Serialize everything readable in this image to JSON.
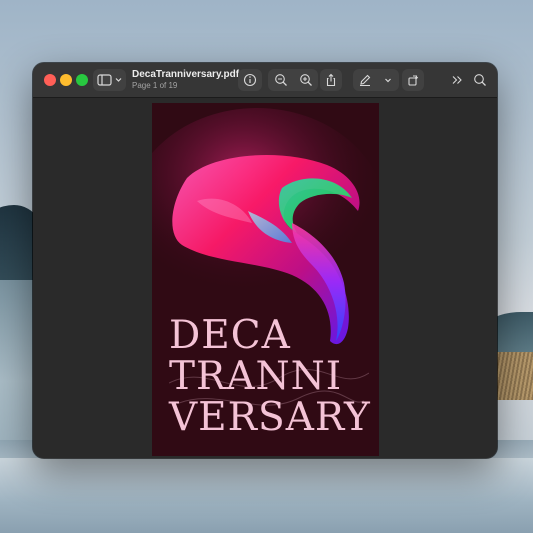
{
  "window": {
    "document_title": "DecaTranniversary.pdf",
    "page_info": "Page 1 of 19"
  },
  "toolbar": {
    "sidebar_icon": "sidebar-icon",
    "info_icon": "info-icon",
    "zoom_out_icon": "zoom-out-icon",
    "zoom_in_icon": "zoom-in-icon",
    "share_icon": "share-icon",
    "markup_icon": "pen-icon",
    "rotate_icon": "rotate-icon",
    "more_icon": "chevrons-right-icon",
    "search_icon": "search-icon"
  },
  "page": {
    "line1": "DECA",
    "line2": "TRANNI",
    "line3": "VERSARY"
  },
  "colors": {
    "page_background": "#300a14",
    "title_text": "#f4c3d6",
    "window_bg": "#2a2a2a"
  }
}
